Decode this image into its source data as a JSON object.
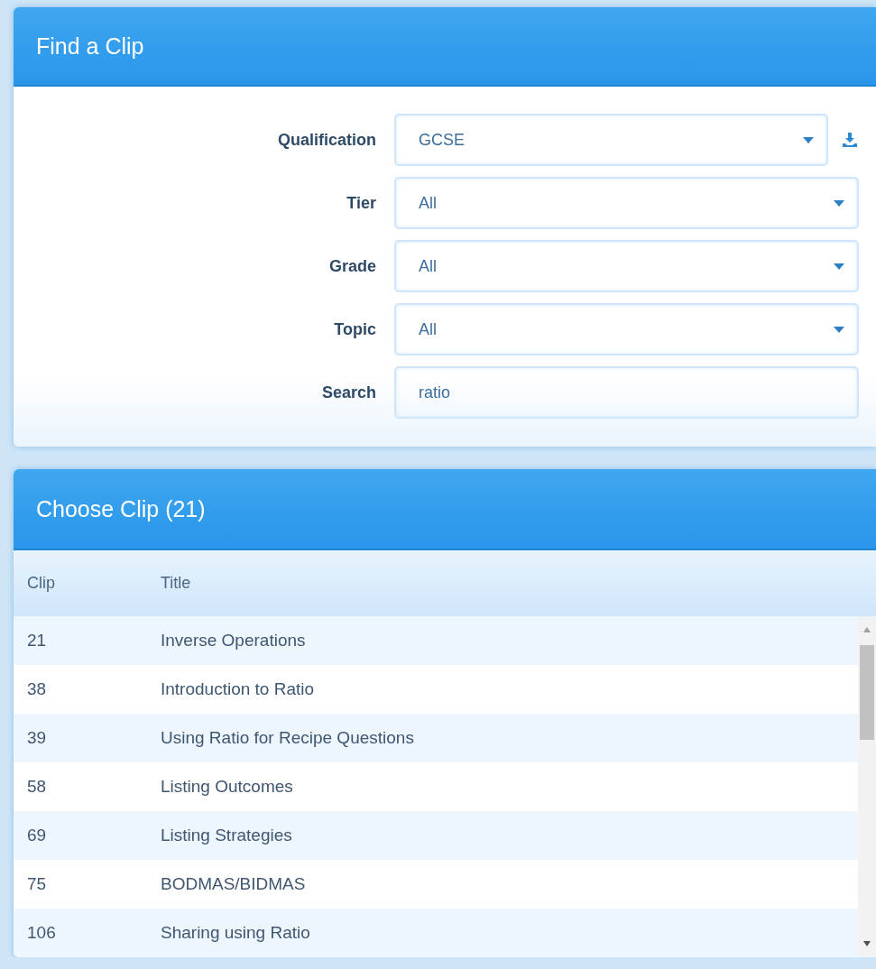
{
  "find_panel": {
    "title": "Find a Clip",
    "fields": [
      {
        "kind": "dropdown",
        "label": "Qualification",
        "value": "GCSE",
        "download": true
      },
      {
        "kind": "dropdown",
        "label": "Tier",
        "value": "All"
      },
      {
        "kind": "dropdown",
        "label": "Grade",
        "value": "All"
      },
      {
        "kind": "dropdown",
        "label": "Topic",
        "value": "All"
      },
      {
        "kind": "text",
        "label": "Search",
        "value": "ratio"
      }
    ]
  },
  "clip_panel": {
    "title": "Choose Clip (21)",
    "columns": [
      "Clip",
      "Title"
    ],
    "rows": [
      [
        "21",
        "Inverse Operations"
      ],
      [
        "38",
        "Introduction to Ratio"
      ],
      [
        "39",
        "Using Ratio for Recipe Questions"
      ],
      [
        "58",
        "Listing Outcomes"
      ],
      [
        "69",
        "Listing Strategies"
      ],
      [
        "75",
        "BODMAS/BIDMAS"
      ],
      [
        "106",
        "Sharing using Ratio"
      ]
    ]
  }
}
